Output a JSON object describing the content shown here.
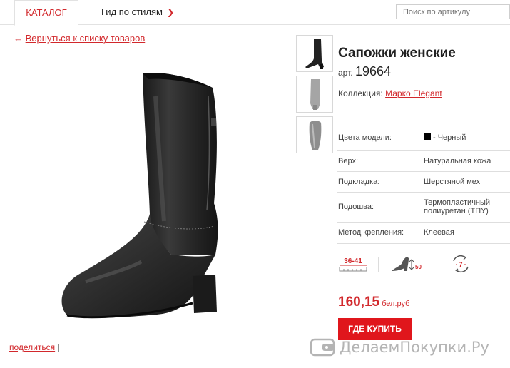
{
  "nav": {
    "tab_catalog": "Каталог",
    "tab_guide": "Гид по стилям",
    "search_placeholder": "Поиск по артикулу"
  },
  "back_link": {
    "arrow": "←",
    "label": "Вернуться к списку товаров"
  },
  "share": {
    "label": "поделиться",
    "separator": "|"
  },
  "product": {
    "title": "Сапожки женские",
    "article_label": "арт.",
    "article_number": "19664",
    "collection_label": "Коллекция:",
    "collection_name": "Марко Elegant",
    "specs": [
      {
        "key": "Цвета модели:",
        "value": "- Черный",
        "swatch": "#000000"
      },
      {
        "key": "Верх:",
        "value": "Натуральная кожа"
      },
      {
        "key": "Подкладка:",
        "value": "Шерстяной мех"
      },
      {
        "key": "Подошва:",
        "value": "Термопластичный полиуретан (ТПУ)"
      },
      {
        "key": "Метод крепления:",
        "value": "Клеевая"
      }
    ],
    "features": {
      "size_range": "36-41",
      "heel_height": "50",
      "width_mark": "7"
    },
    "price": "160,15",
    "currency": "бел.руб",
    "buy_button": "Где купить"
  },
  "watermark": "ДелаемПокупки.Ру",
  "colors": {
    "accent": "#d2282c",
    "button": "#e0161c"
  }
}
